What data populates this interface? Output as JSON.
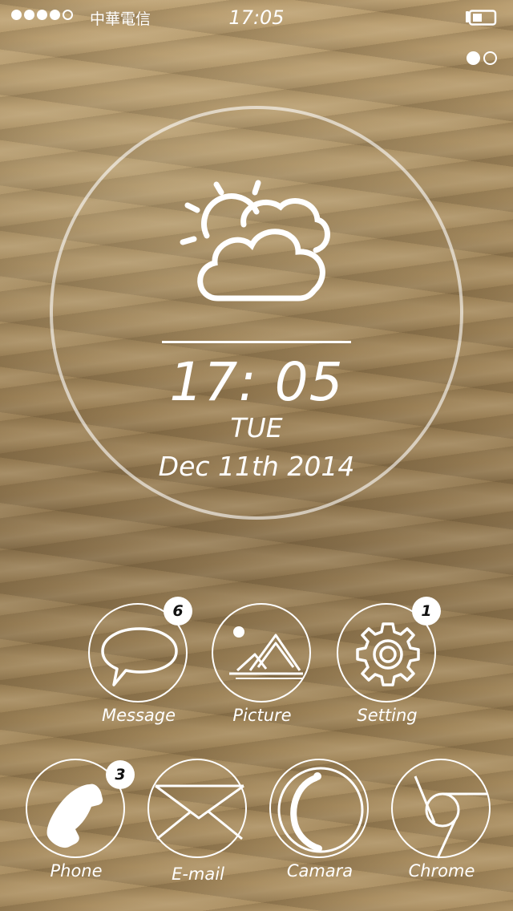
{
  "status_bar": {
    "carrier": "中華電信",
    "time": "17:05",
    "signal_icon": "signal-dots-icon",
    "battery_icon": "battery-icon"
  },
  "pager": {
    "pages": 2,
    "current": 1
  },
  "widget": {
    "weather_icon": "partly-cloudy-icon",
    "time": "17: 05",
    "weekday": "TUE",
    "date": "Dec 11th 2014"
  },
  "apps": {
    "message": {
      "label": "Message",
      "badge": "6",
      "icon": "speech-bubble-icon"
    },
    "picture": {
      "label": "Picture",
      "icon": "mountain-picture-icon"
    },
    "setting": {
      "label": "Setting",
      "badge": "1",
      "icon": "gear-icon"
    },
    "phone": {
      "label": "Phone",
      "badge": "3",
      "icon": "phone-handset-icon"
    },
    "email": {
      "label": "E-mail",
      "icon": "envelope-icon"
    },
    "camera": {
      "label": "Camara",
      "icon": "camera-lens-icon"
    },
    "chrome": {
      "label": "Chrome",
      "icon": "chrome-icon"
    }
  },
  "colors": {
    "foreground": "#ffffff",
    "badge_bg": "#ffffff",
    "badge_text": "#111111"
  }
}
